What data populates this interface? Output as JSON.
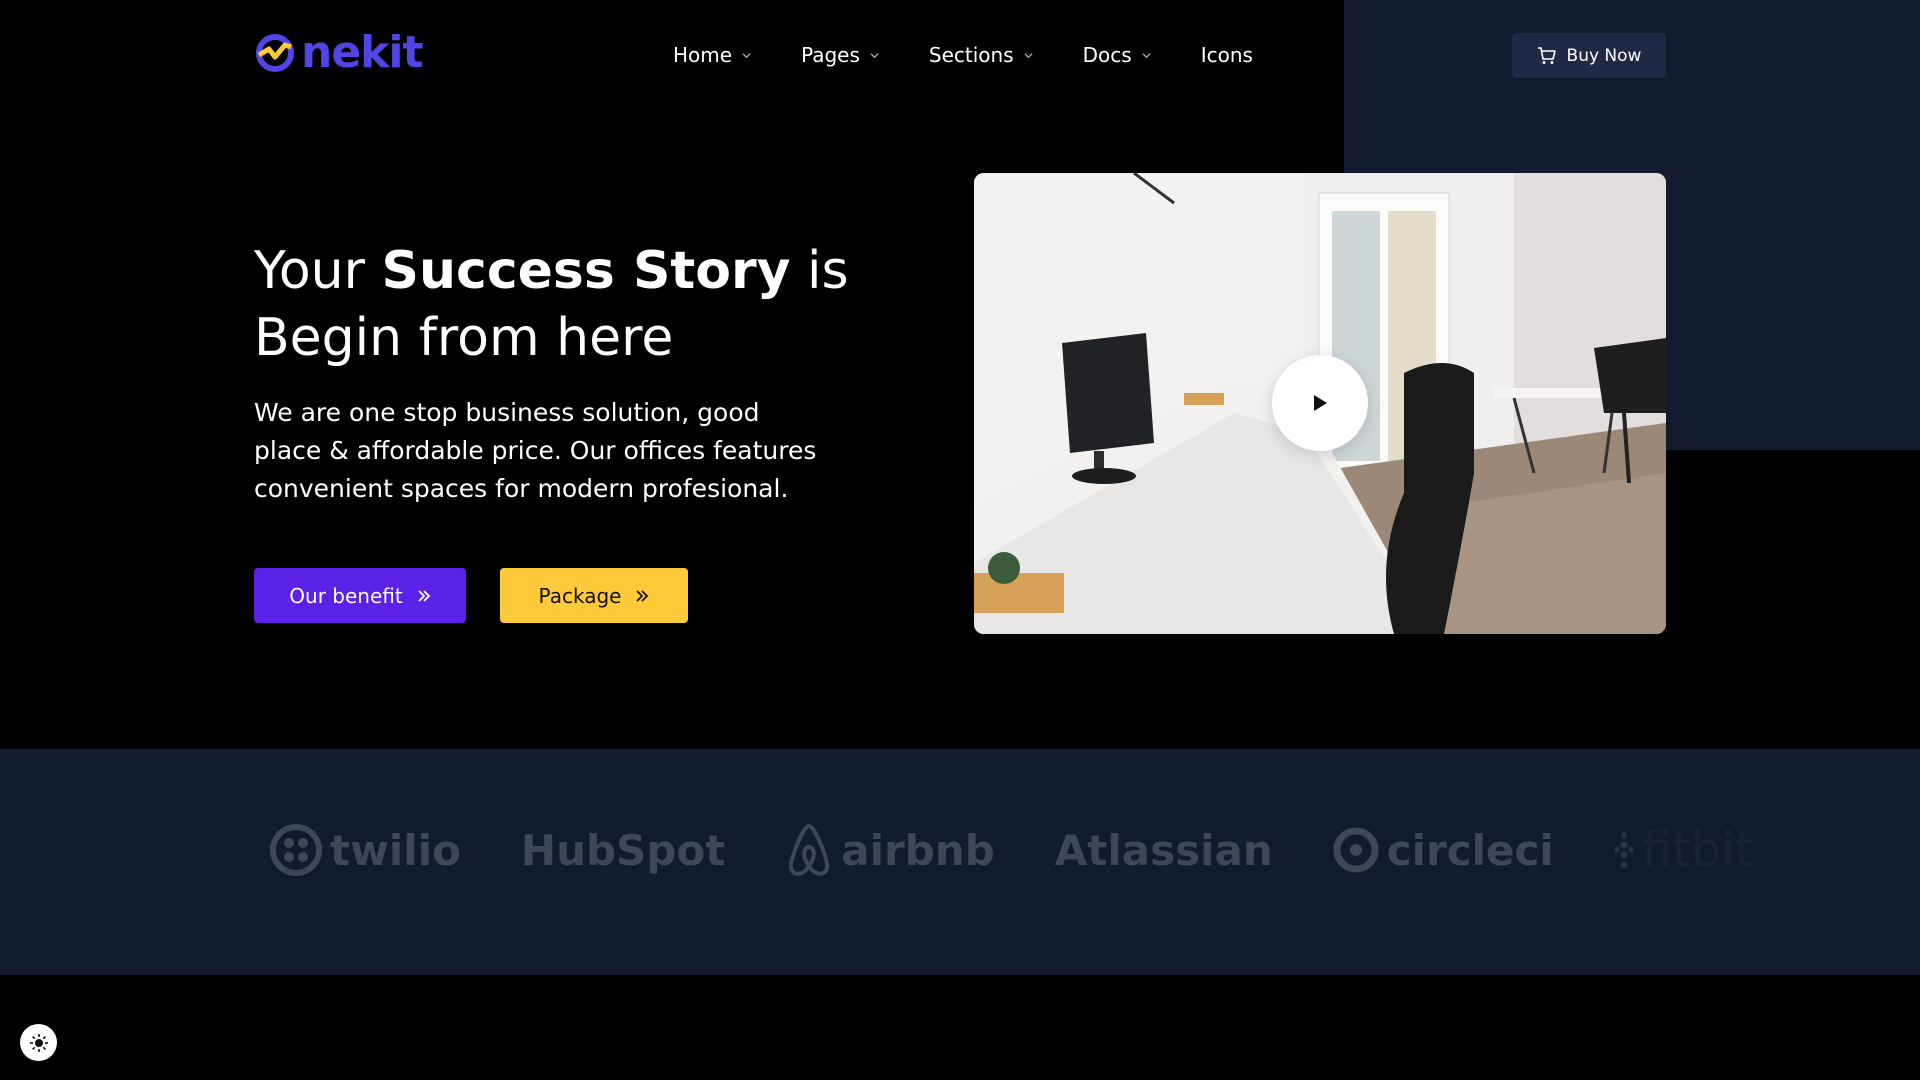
{
  "nav": {
    "logo_text": "nekit",
    "menu": [
      {
        "label": "Home",
        "has_dropdown": true
      },
      {
        "label": "Pages",
        "has_dropdown": true
      },
      {
        "label": "Sections",
        "has_dropdown": true
      },
      {
        "label": "Docs",
        "has_dropdown": true
      },
      {
        "label": "Icons",
        "has_dropdown": false
      }
    ],
    "buy_label": "Buy Now",
    "buy_icon": "cart-icon"
  },
  "hero": {
    "title_pre": "Your ",
    "title_bold": "Success Story",
    "title_post": " is Begin from here",
    "text": "We are one stop business solution, good place & affordable price. Our offices features convenient spaces for modern profesional.",
    "btn_benefit": "Our benefit",
    "btn_package": "Package"
  },
  "brands": [
    {
      "name": "twilio"
    },
    {
      "name": "HubSpot"
    },
    {
      "name": "airbnb"
    },
    {
      "name": "Atlassian"
    },
    {
      "name": "circleci"
    },
    {
      "name": "fitbit"
    }
  ],
  "colors": {
    "primary": "#5b21e6",
    "accent": "#ffca3a",
    "logo": "#4f46e5",
    "panel": "#111a2e"
  }
}
